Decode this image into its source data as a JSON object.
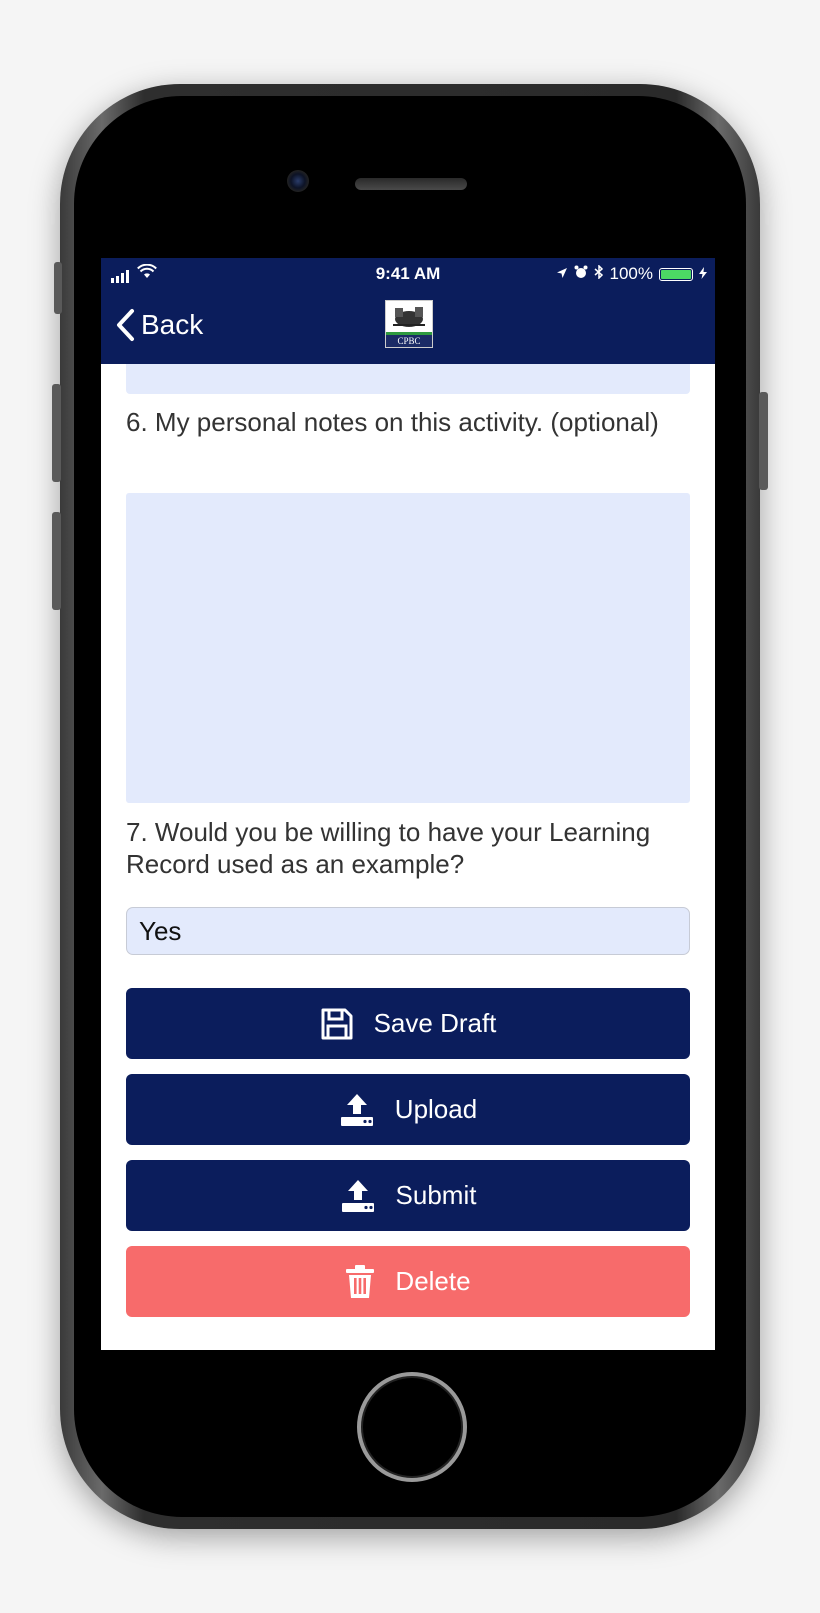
{
  "status_bar": {
    "time": "9:41 AM",
    "battery": "100%"
  },
  "nav": {
    "back_label": "Back",
    "logo_text": "CPBC"
  },
  "form": {
    "question_6": "6. My personal notes on this activity. (optional)",
    "notes_value": "",
    "question_7": "7. Would you be willing to have your Learning Record used as an example?",
    "example_answer": "Yes"
  },
  "actions": {
    "save_draft": "Save Draft",
    "upload": "Upload",
    "submit": "Submit",
    "delete": "Delete"
  },
  "colors": {
    "nav_background": "#0b1d5c",
    "field_background": "#e3eafc",
    "button_primary": "#0b1d5c",
    "button_danger": "#f76b6b"
  },
  "icons": [
    "signal-icon",
    "wifi-icon",
    "location-icon",
    "alarm-icon",
    "bluetooth-icon",
    "battery-icon",
    "back-chevron-icon",
    "save-icon",
    "upload-icon",
    "trash-icon"
  ]
}
